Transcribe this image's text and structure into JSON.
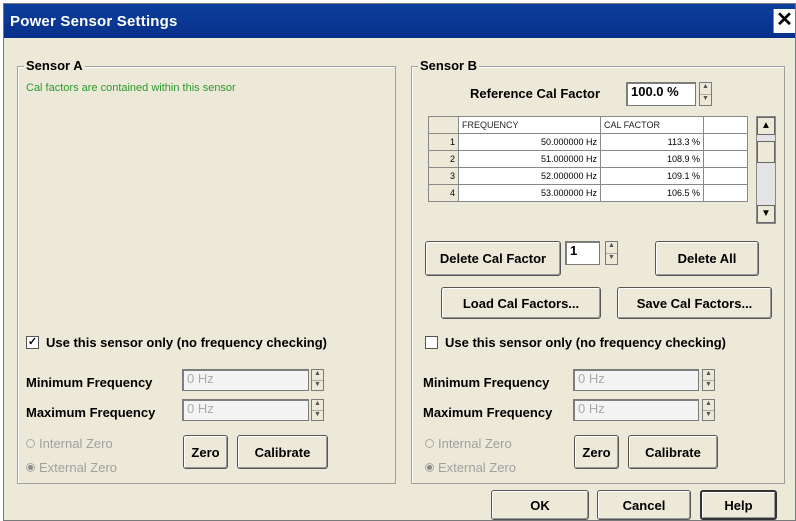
{
  "window": {
    "title": "Power Sensor Settings",
    "close_glyph": "✕"
  },
  "sensor_a": {
    "title": "Sensor A",
    "note": "Cal factors are contained within this sensor",
    "use_only_label": "Use this sensor only (no frequency checking)",
    "use_only_checked": true,
    "min_freq_label": "Minimum Frequency",
    "min_freq_value": "0 Hz",
    "max_freq_label": "Maximum Frequency",
    "max_freq_value": "0 Hz",
    "internal_zero": "Internal Zero",
    "external_zero": "External Zero",
    "zero_label": "Zero",
    "calibrate_label": "Calibrate"
  },
  "sensor_b": {
    "title": "Sensor B",
    "ref_cal_label": "Reference Cal Factor",
    "ref_cal_value": "100.0 %",
    "table": {
      "headers": [
        "FREQUENCY",
        "CAL FACTOR"
      ],
      "rows": [
        {
          "n": "1",
          "freq": "50.000000 Hz",
          "cal": "113.3 %"
        },
        {
          "n": "2",
          "freq": "51.000000 Hz",
          "cal": "108.9 %"
        },
        {
          "n": "3",
          "freq": "52.000000 Hz",
          "cal": "109.1 %"
        },
        {
          "n": "4",
          "freq": "53.000000 Hz",
          "cal": "106.5 %"
        }
      ]
    },
    "delete_cal_label": "Delete Cal Factor",
    "delete_index": "1",
    "delete_all_label": "Delete All",
    "load_label": "Load Cal Factors...",
    "save_label": "Save Cal Factors...",
    "use_only_label": "Use this sensor only (no frequency checking)",
    "use_only_checked": false,
    "min_freq_label": "Minimum Frequency",
    "min_freq_value": "0 Hz",
    "max_freq_label": "Maximum Frequency",
    "max_freq_value": "0 Hz",
    "internal_zero": "Internal Zero",
    "external_zero": "External Zero",
    "zero_label": "Zero",
    "calibrate_label": "Calibrate"
  },
  "footer": {
    "ok_label": "OK",
    "cancel_label": "Cancel",
    "help_label": "Help"
  },
  "colors": {
    "titlebar": "#0b3f9c",
    "dialog_bg": "#ece9d8",
    "note_green": "#2a9a2a"
  }
}
